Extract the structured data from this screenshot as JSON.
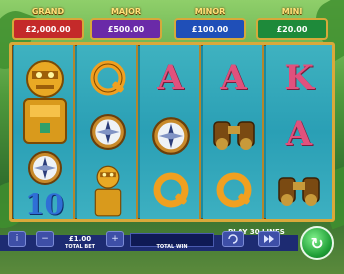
{
  "jackpots": [
    {
      "name": "GRAND",
      "value": "£2,000.00",
      "color": "#c42a2a"
    },
    {
      "name": "MAJOR",
      "value": "£500.00",
      "color": "#6a2aa8"
    },
    {
      "name": "MINOR",
      "value": "£100.00",
      "color": "#1f4fb8"
    },
    {
      "name": "MINI",
      "value": "£20.00",
      "color": "#1e8a3a"
    }
  ],
  "reels": [
    [
      "gold-idol-top",
      "gold-idol",
      "compass"
    ],
    [
      "Q",
      "compass",
      "gold-idol"
    ],
    [
      "A",
      "compass",
      "Q"
    ],
    [
      "A",
      "binoculars",
      "Q"
    ],
    [
      "K",
      "A",
      "binoculars"
    ]
  ],
  "reel_row3_first": "10",
  "letters": {
    "A": "A",
    "K": "K",
    "Q": "Q",
    "ten": "10"
  },
  "bet": {
    "value": "£1.00",
    "label": "TOTAL BET"
  },
  "win": {
    "value": "",
    "label": "TOTAL WIN"
  },
  "lines_text": "PLAY 30 LINES",
  "buttons": {
    "info": "i",
    "minus": "−",
    "plus": "+",
    "spin": "↻"
  },
  "colors": {
    "frame": "#d9a93a",
    "reel_bg": "#2a9fb5",
    "panel": "#1d2b72",
    "spin": "#1e9d35"
  }
}
